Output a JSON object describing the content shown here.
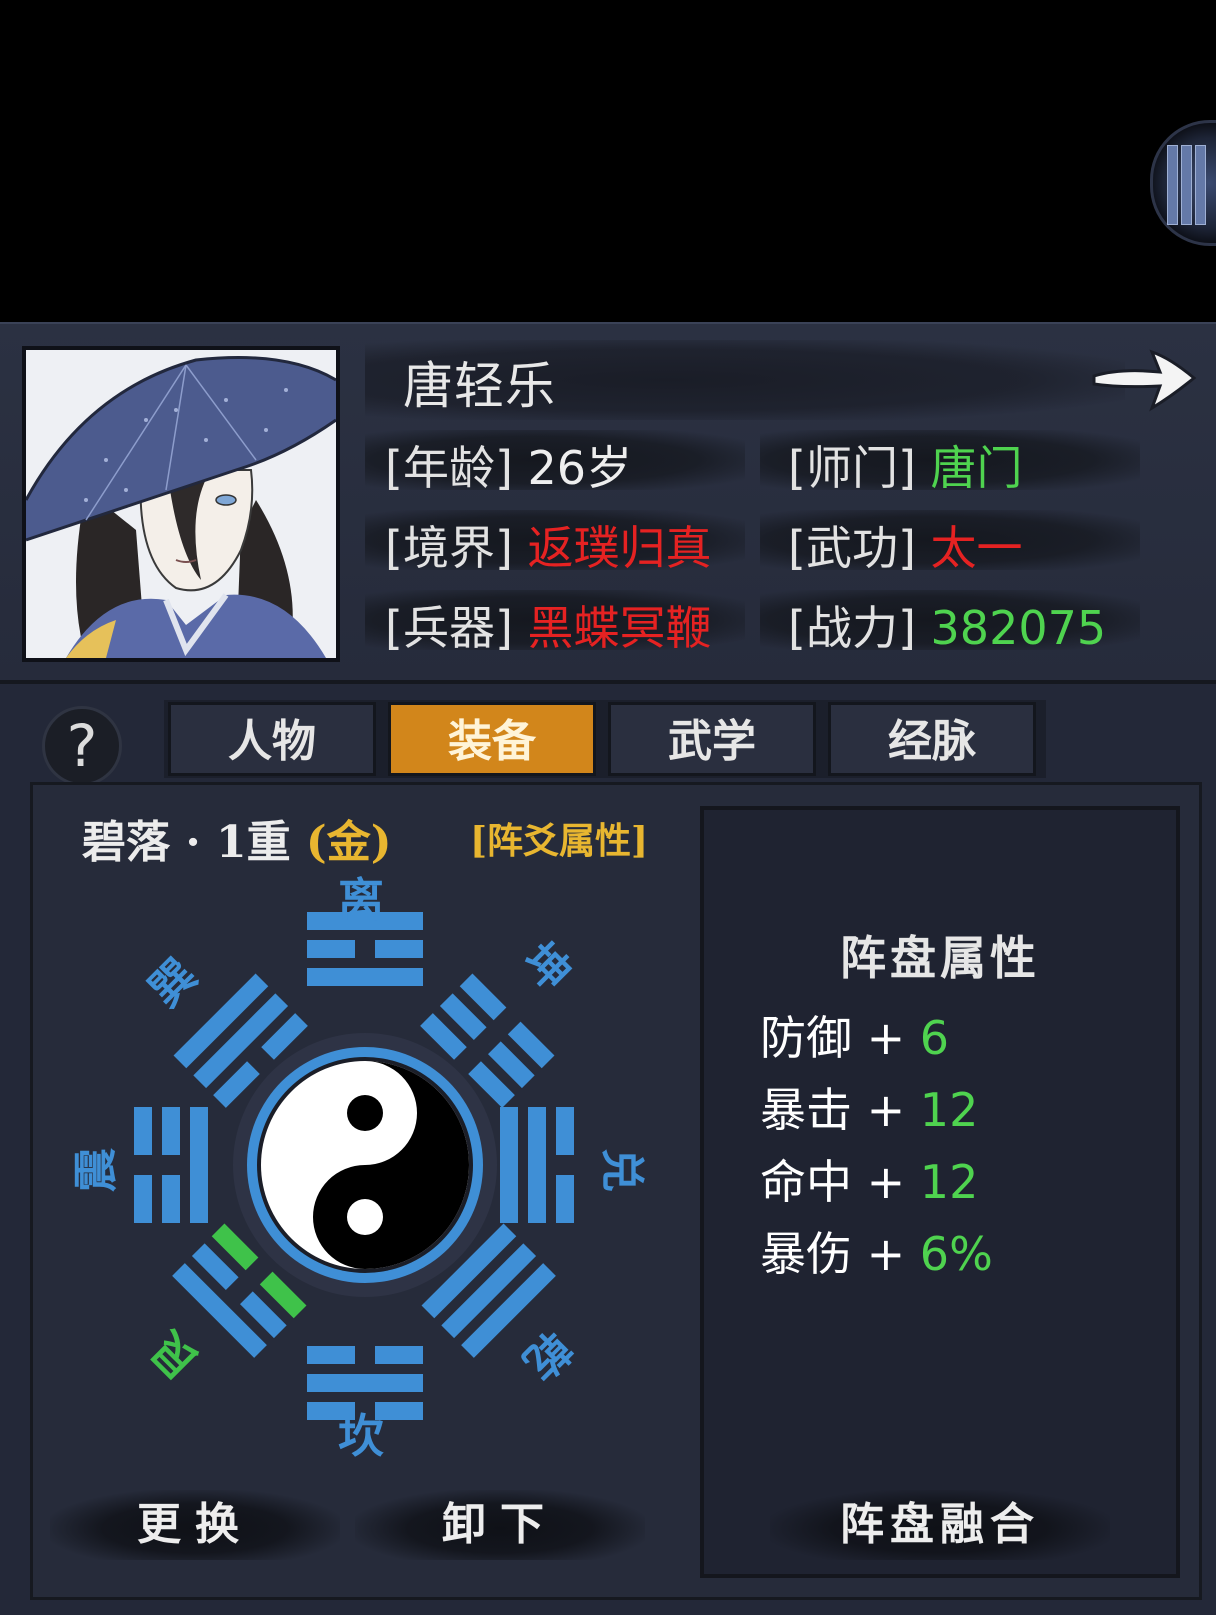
{
  "character": {
    "name": "唐轻乐",
    "age_label": "[年龄]",
    "age_value": "26岁",
    "sect_label": "[师门]",
    "sect_value": "唐门",
    "realm_label": "[境界]",
    "realm_value": "返璞归真",
    "martial_label": "[武功]",
    "martial_value": "太一",
    "weapon_label": "[兵器]",
    "weapon_value": "黑蝶冥鞭",
    "power_label": "[战力]",
    "power_value": "382075"
  },
  "tabs": [
    {
      "label": "人物",
      "active": false
    },
    {
      "label": "装备",
      "active": true
    },
    {
      "label": "武学",
      "active": false
    },
    {
      "label": "经脉",
      "active": false
    }
  ],
  "help_label": "?",
  "formation": {
    "name_prefix": "碧落 · 1重 ",
    "grade": "(金)",
    "attr_link": "[阵爻属性]",
    "trigrams": {
      "li": "离",
      "kun": "坤",
      "dui": "兑",
      "qian": "乾",
      "kan": "坎",
      "gen": "艮",
      "zhen": "震",
      "xun": "巽"
    }
  },
  "panel": {
    "title": "阵盘属性",
    "stats": [
      {
        "name": "防御",
        "sep": " + ",
        "value": "6"
      },
      {
        "name": "暴击",
        "sep": " + ",
        "value": "12"
      },
      {
        "name": "命中",
        "sep": " + ",
        "value": "12"
      },
      {
        "name": "暴伤",
        "sep": " + ",
        "value": "6%"
      }
    ]
  },
  "buttons": {
    "replace": "更换",
    "unequip": "卸下",
    "fuse": "阵盘融合"
  },
  "colors": {
    "trigram_blue": "#3f8fd6",
    "highlight_green": "#3fc24a",
    "active_tab": "#d2861b",
    "value_red": "#e52222",
    "value_green": "#4fd34f",
    "gold": "#e8b630"
  },
  "icons": {
    "next": "arrow-right-icon",
    "help": "question-mark-icon"
  }
}
